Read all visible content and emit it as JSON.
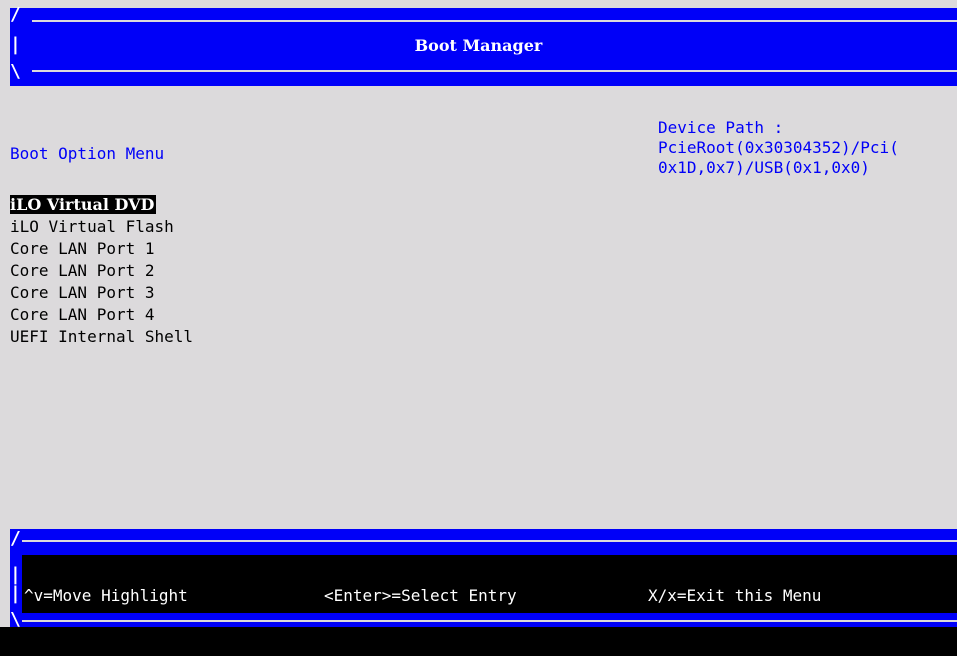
{
  "header": {
    "title": "Boot Manager"
  },
  "menu": {
    "heading": "Boot Option Menu",
    "items": [
      {
        "label": "iLO Virtual DVD",
        "selected": true
      },
      {
        "label": "iLO Virtual Flash",
        "selected": false
      },
      {
        "label": "Core LAN Port 1",
        "selected": false
      },
      {
        "label": "Core LAN Port 2",
        "selected": false
      },
      {
        "label": "Core LAN Port 3",
        "selected": false
      },
      {
        "label": "Core LAN Port 4",
        "selected": false
      },
      {
        "label": "UEFI Internal Shell",
        "selected": false
      }
    ]
  },
  "device_path": {
    "label": "Device Path :",
    "line1": "PcieRoot(0x30304352)/Pci(",
    "line2": "0x1D,0x7)/USB(0x1,0x0)"
  },
  "footer": {
    "move_hint": "^v=Move Highlight",
    "select_hint": "<Enter>=Select Entry",
    "exit_hint": "X/x=Exit this Menu"
  },
  "colors": {
    "background": "#dcdadc",
    "frame_blue": "#0000f8",
    "text_blue": "#0000f8",
    "highlight": "#000000"
  }
}
